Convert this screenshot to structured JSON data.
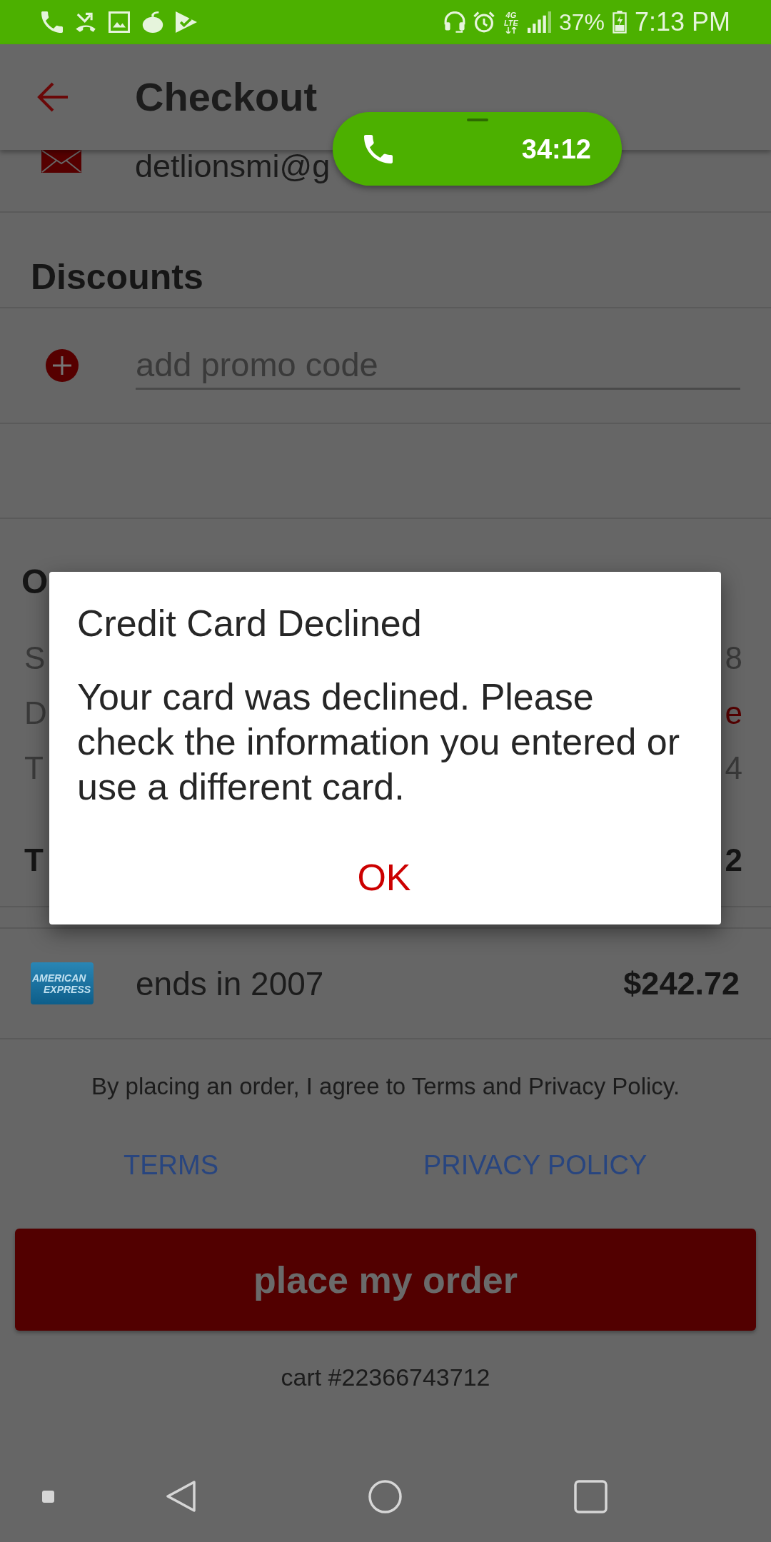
{
  "status_bar": {
    "network": "4G LTE",
    "battery": "37%",
    "time": "7:13 PM"
  },
  "app_bar": {
    "title": "Checkout"
  },
  "call_bubble": {
    "duration": "34:12"
  },
  "contact": {
    "email": "detlionsmi@g"
  },
  "discounts": {
    "title": "Discounts",
    "promo_field": {
      "placeholder": "add promo code"
    }
  },
  "order_summary": {
    "title": "O",
    "rows": [
      {
        "kind": "normal",
        "label": "S",
        "value": "8"
      },
      {
        "kind": "highlight",
        "label": "D",
        "value": "e"
      },
      {
        "kind": "normal",
        "label": "T",
        "value": "4"
      },
      {
        "kind": "total",
        "label": "T",
        "value": "2"
      }
    ]
  },
  "payment": {
    "card_logo": [
      "AMERICAN",
      "EXPRESS"
    ],
    "card": "ends in 2007",
    "amount": "$242.72"
  },
  "agreement": "By placing an order, I agree to Terms and Privacy Policy.",
  "links": [
    "TERMS",
    "PRIVACY POLICY"
  ],
  "place_order_button": "place my order",
  "cart_number": "cart #22366743712",
  "dialog": {
    "title": "Credit Card Declined",
    "message": "Your card was declined. Please check the information you entered or use a different card.",
    "buttons": [
      "OK"
    ]
  }
}
